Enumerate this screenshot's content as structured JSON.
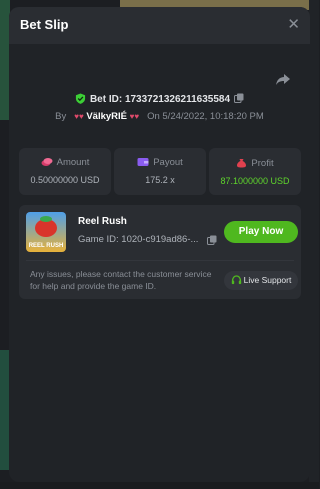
{
  "header": {
    "title": "Bet Slip"
  },
  "bet": {
    "id_label": "Bet ID: 17337213262116355​84",
    "by_label": "By",
    "user": "VälkyRIÉ",
    "on_label": "On",
    "date": "5/24/2022, 10:18:20 PM"
  },
  "stats": {
    "amount_label": "Amount",
    "amount_value": "0.50000000 USD",
    "payout_label": "Payout",
    "payout_value": "175.2 x",
    "profit_label": "Profit",
    "profit_value": "87.1000000 USD"
  },
  "game": {
    "name": "Reel Rush",
    "id_label": "Game ID: 1020-c919ad86-...",
    "play_label": "Play Now",
    "thumb_text": "REEL RUSH"
  },
  "support": {
    "notice": "Any issues, please contact the customer service for help and provide the game ID.",
    "button_label": "Live Support"
  },
  "colors": {
    "accent_green": "#4fb81f",
    "profit_green": "#5fd52c"
  }
}
